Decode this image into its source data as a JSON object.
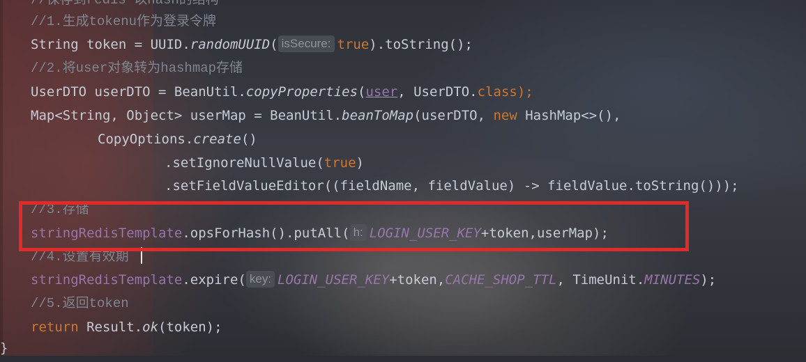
{
  "code": {
    "line0": "//保存到redis 以hash的结构",
    "line1": "//1.生成tokenu作为登录令牌",
    "line2": {
      "a": "String token = UUID.",
      "b": "randomUUID",
      "c": "(",
      "hint": "isSecure:",
      "d": "true",
      "e": ").toString();"
    },
    "line3": "//2.将user对象转为hashmap存储",
    "line4": {
      "a": "UserDTO userDTO = BeanUtil.",
      "b": "copyProperties",
      "c": "(",
      "d": "user",
      "e": ", UserDTO.",
      "f": "class",
      "g": ");"
    },
    "line5": {
      "a": "Map<String, Object> userMap = BeanUtil.",
      "b": "beanToMap",
      "c": "(userDTO, ",
      "d": "new",
      "e": " HashMap<>(),"
    },
    "line6": {
      "a": "CopyOptions.",
      "b": "create",
      "c": "()"
    },
    "line7": {
      "a": ".setIgnoreNullValue(",
      "b": "true",
      "c": ")"
    },
    "line8": ".setFieldValueEditor((fieldName, fieldValue) -> fieldValue.toString()));",
    "line9": "//3.存储",
    "line10": {
      "a": "stringRedisTemplate",
      "b": ".opsForHash().putAll(",
      "hint": "h:",
      "c": "LOGIN_USER_KEY",
      "d": "+token,userMap);"
    },
    "line11": "//4.设置有效期",
    "line12": {
      "a": "stringRedisTemplate",
      "b": ".expire(",
      "hint": "key:",
      "c": "LOGIN_USER_KEY",
      "d": "+token,",
      "e": "CACHE_SHOP_TTL",
      "f": ", TimeUnit.",
      "g": "MINUTES",
      "h": ");"
    },
    "line13": "//5.返回token",
    "line14": {
      "a": "return",
      "b": " Result.",
      "c": "ok",
      "d": "(token);"
    },
    "closing": "}"
  }
}
